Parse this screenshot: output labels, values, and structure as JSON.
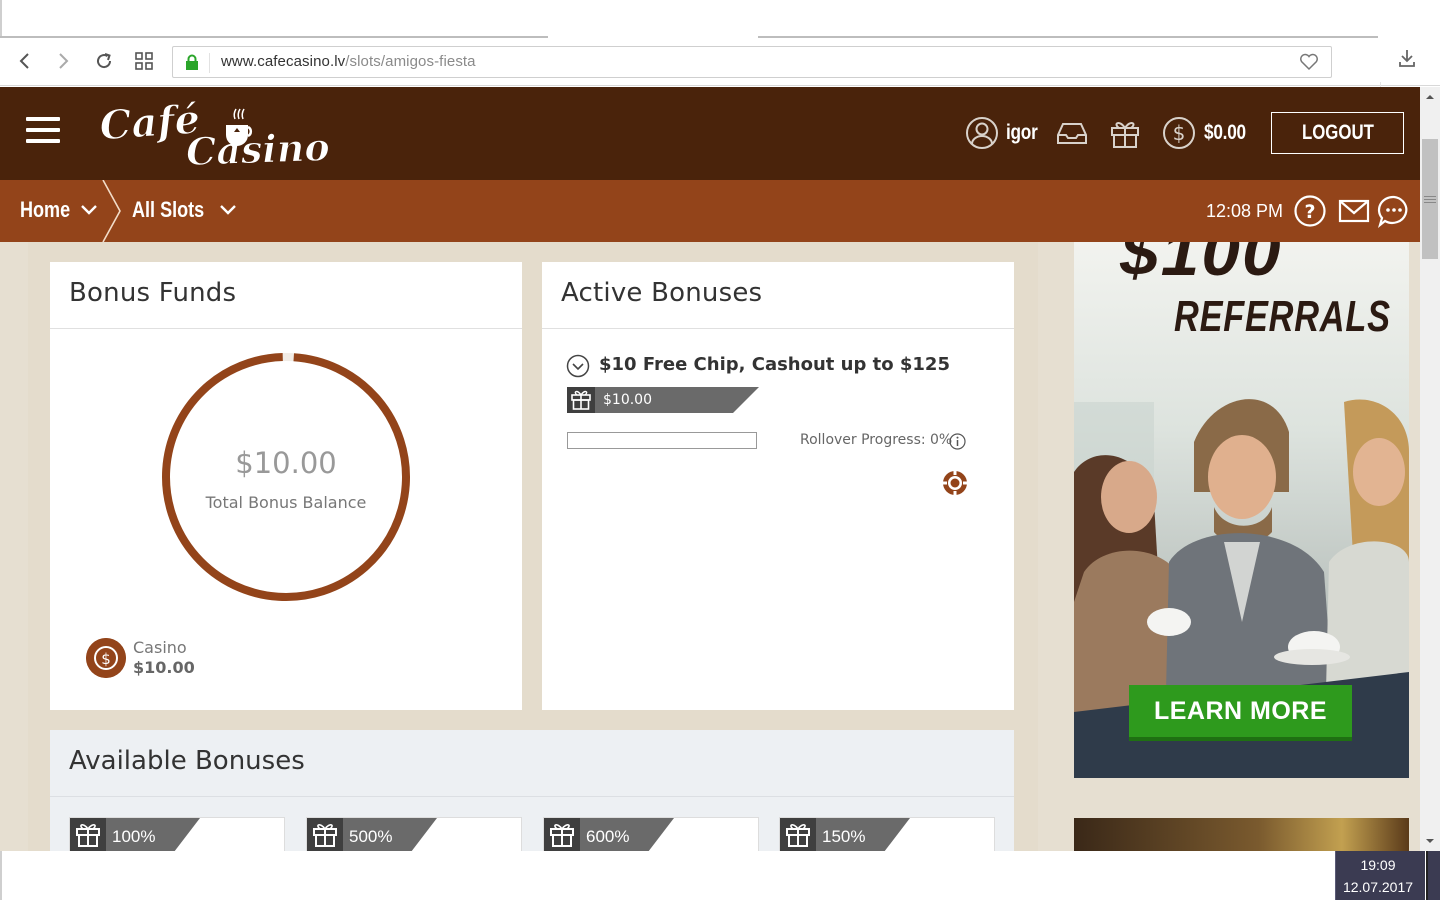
{
  "browser": {
    "url_host": "www.cafecasino.lv",
    "url_path": "/slots/amigos-fiesta"
  },
  "header": {
    "logo_alt": "Café Casino",
    "username": "igor",
    "balance": "$0.00",
    "logout_label": "LOGOUT"
  },
  "nav": {
    "home_label": "Home",
    "section_label": "All Slots",
    "time": "12:08 PM"
  },
  "bonus_funds": {
    "title": "Bonus Funds",
    "total_amount": "$10.00",
    "total_label": "Total Bonus Balance",
    "casino_label": "Casino",
    "casino_value": "$10.00",
    "ring_fill": 0.985
  },
  "active_bonuses": {
    "title": "Active Bonuses",
    "bonus_name": "$10 Free Chip, Cashout up to $125",
    "bonus_amount": "$10.00",
    "rollover_label": "Rollover Progress: 0%",
    "rollover_progress": 0
  },
  "available_bonuses": {
    "title": "Available Bonuses",
    "cards": [
      {
        "percent": "100%"
      },
      {
        "percent": "500%"
      },
      {
        "percent": "600%"
      },
      {
        "percent": "150%"
      }
    ]
  },
  "ad": {
    "headline": "$100",
    "subline": "REFERRALS",
    "cta": "LEARN MORE"
  },
  "taskbar": {
    "time": "19:09",
    "date": "12.07.2017"
  },
  "colors": {
    "header_dark": "#4a230b",
    "nav_brown": "#93441a",
    "accent": "#93441a",
    "cta_green": "#2e9a1d"
  }
}
